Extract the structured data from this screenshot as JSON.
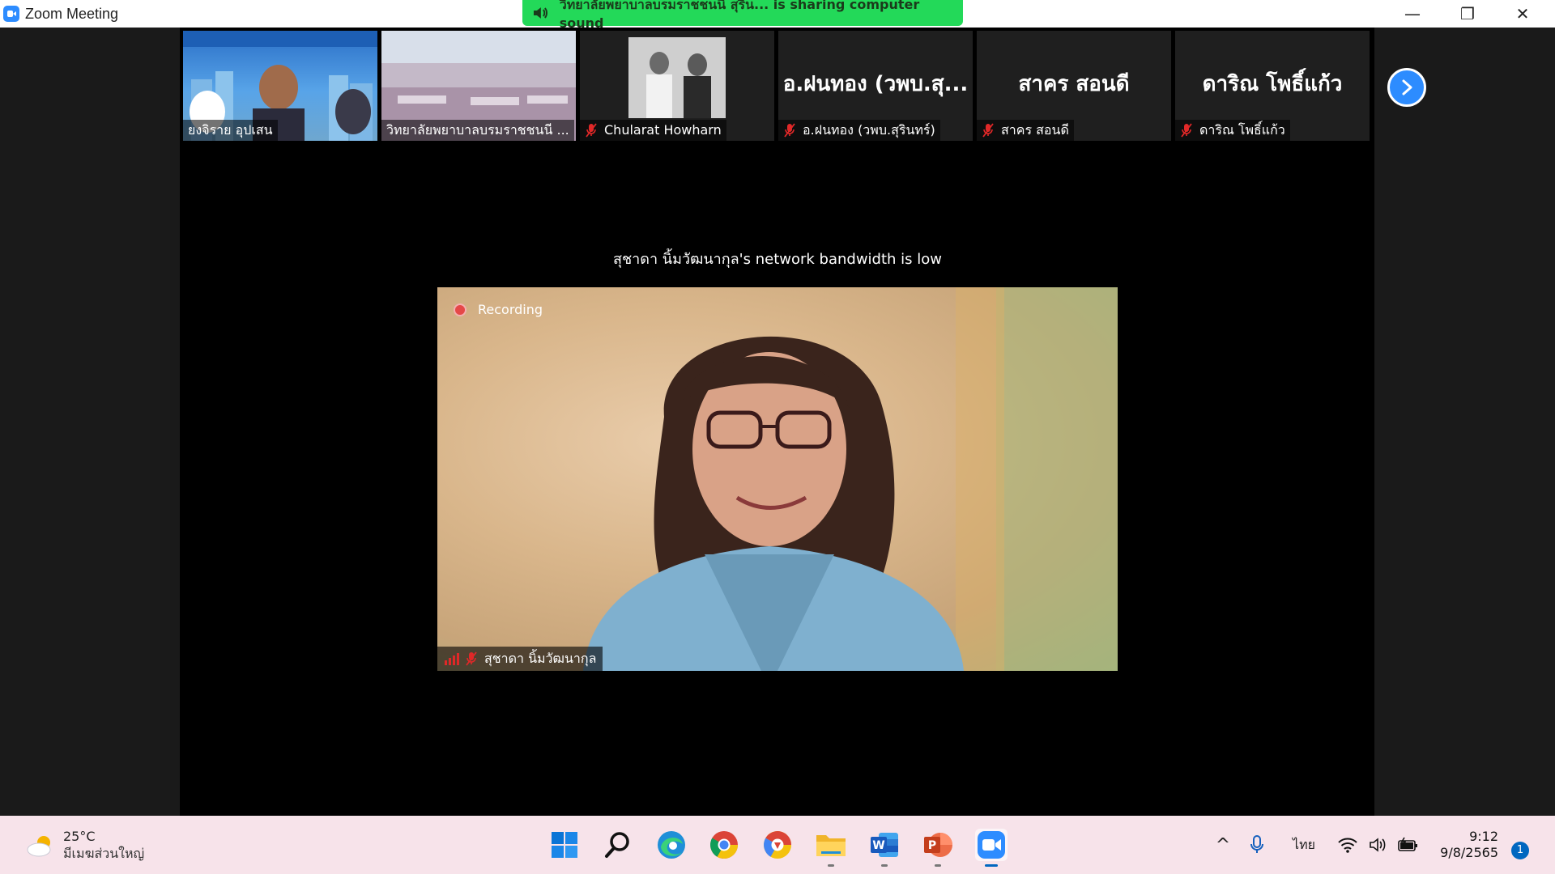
{
  "window": {
    "title": "Zoom Meeting",
    "minimize_glyph": "—",
    "maximize_glyph": "❐",
    "close_glyph": "✕"
  },
  "share_banner": {
    "text": "วิทยาลัยพยาบาลบรมราชชนนี สุริน... is sharing computer sound",
    "icon": "speaker-icon"
  },
  "thumbnails": [
    {
      "name": "ยงจิราย อุปเสน",
      "muted": false,
      "video": true
    },
    {
      "name": "วิทยาลัยพยาบาลบรมราชชนนี ...",
      "muted": false,
      "video": true
    },
    {
      "name": "Chularat Howharn",
      "muted": true,
      "video": true
    },
    {
      "name": "อ.ฝนทอง (วพบ.สุรินทร์)",
      "big_label": "อ.ฝนทอง (วพบ.สุ...",
      "muted": true,
      "video": false
    },
    {
      "name": "สาคร  สอนดี",
      "big_label": "สาคร  สอนดี",
      "muted": true,
      "video": false
    },
    {
      "name": "ดาริณ  โพธิ์แก้ว",
      "big_label": "ดาริณ  โพธิ์แก้ว",
      "muted": true,
      "video": false
    }
  ],
  "next_page_icon": "chevron-right-icon",
  "bandwidth_notice": "สุชาดา  นิ้มวัฒนากุล's network bandwidth is low",
  "main_video": {
    "recording_label": "Recording",
    "participant_name": "สุชาดา  นิ้มวัฒนากุล",
    "muted": true
  },
  "taskbar": {
    "weather_temp": "25°C",
    "weather_desc": "มีเมฆส่วนใหญ่",
    "apps": [
      "windows-start-icon",
      "search-icon",
      "edge-icon",
      "chrome-icon",
      "chrome-alt-icon",
      "file-explorer-icon",
      "word-icon",
      "powerpoint-icon",
      "zoom-icon"
    ],
    "tray_chevron": "^",
    "language": "ไทย",
    "time": "9:12",
    "date": "9/8/2565",
    "notification_count": "1"
  },
  "colors": {
    "zoom_blue": "#2D8CFF",
    "share_green": "#23D959",
    "recording_red": "#e54848",
    "mute_red": "#e02828",
    "taskbar_bg": "#f7e3ea"
  }
}
